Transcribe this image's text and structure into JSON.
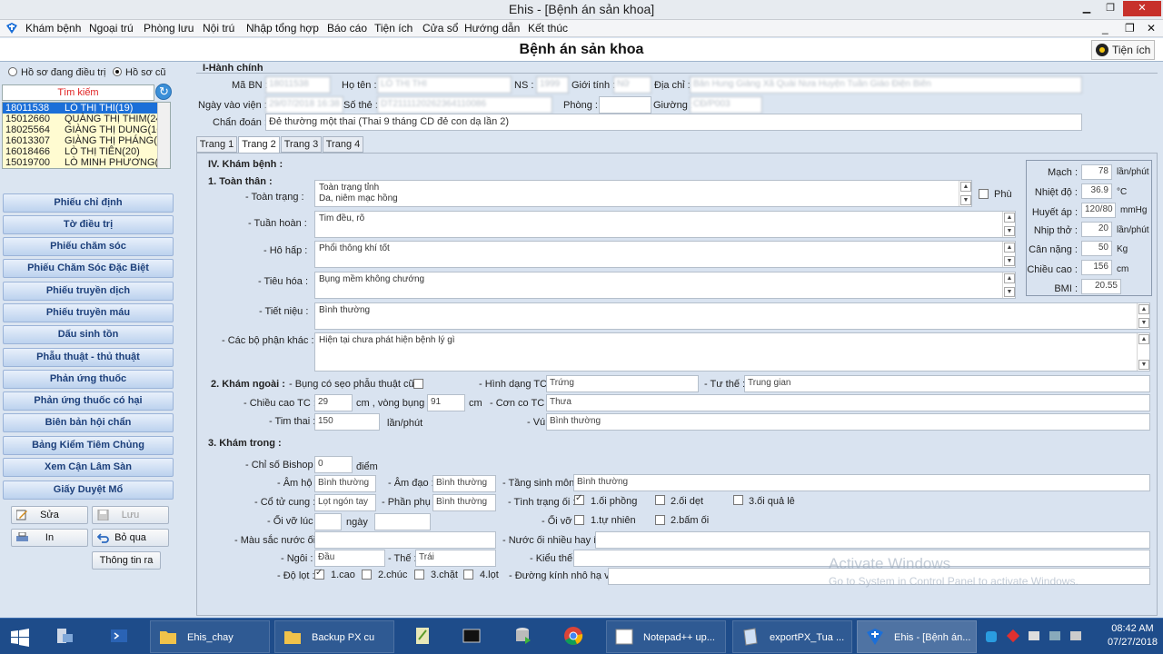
{
  "window": {
    "title": "Ehis - [Bệnh án sản khoa]",
    "controls": [
      "▁",
      "❐",
      "✕"
    ],
    "inner_controls": [
      "_",
      "❐",
      "✕"
    ]
  },
  "menu": [
    "Khám bệnh",
    "Ngoại trú",
    "Phòng lưu",
    "Nội trú",
    "Nhập tổng hợp",
    "Báo cáo",
    "Tiện ích",
    "Cửa sổ",
    "Hướng dẫn",
    "Kết thúc"
  ],
  "page_title": "Bệnh án sản khoa",
  "tienich_label": "Tiện ích",
  "left": {
    "radio1": "Hồ sơ đang điều trị",
    "radio2": "Hồ sơ cũ",
    "search_label": "Tìm kiếm",
    "patients": [
      [
        "18011538",
        "LÒ THỊ THI(19)"
      ],
      [
        "15012660",
        "QUÀNG THỊ THIM(24)"
      ],
      [
        "18025564",
        "GIÀNG THỊ DUNG(16)"
      ],
      [
        "16013307",
        "GIÀNG THỊ PHÁNG(19)"
      ],
      [
        "16018466",
        "LÒ THỊ TIÊN(20)"
      ],
      [
        "15019700",
        "LÒ MINH PHƯƠNG(18)"
      ]
    ],
    "nav": [
      "Phiếu chỉ định",
      "Tờ điều trị",
      "Phiếu chăm sóc",
      "Phiếu Chăm Sóc Đặc Biệt",
      "Phiếu truyền dịch",
      "Phiếu truyền máu",
      "Dấu sinh tồn",
      "Phẫu thuật - thủ thuật",
      "Phản ứng thuốc",
      "Phản ứng thuốc có hại",
      "Biên bản hội chẩn",
      "Bảng Kiểm Tiêm Chủng",
      "Xem Cận Lâm Sàn",
      "Giấy Duyệt Mổ"
    ],
    "sua": "Sửa",
    "luu": "Lưu",
    "in": "In",
    "boqua": "Bỏ qua",
    "thongtinra": "Thông tin ra"
  },
  "hanhchinh": {
    "title": "I-Hành chính",
    "maBN_label": "Mã BN :",
    "maBN": "18011538",
    "hoten_label": "Họ tên :",
    "hoten": "LÒ THỊ THI",
    "ns_label": "NS :",
    "ns": "1999",
    "gioitinh_label": "Giới tính :",
    "gioitinh": "Nữ",
    "diachi_label": "Địa chỉ :",
    "diachi": "Bản Hung Giàng Xã Quài Nưa Huyện Tuần Giáo Điện Biên",
    "ngayvao_label": "Ngày vào viện :",
    "ngayvao": "29/07/2018 16:38",
    "sothe_label": "Số thẻ :",
    "sothe": "DT2111120262364110086",
    "phong_label": "Phòng :",
    "phong": "",
    "giuong_label": "Giường :",
    "giuong": "CĐ/P003",
    "chandoan_label": "Chẩn đoán :",
    "chandoan": "Đẻ thường một thai (Thai 9 tháng CD đẻ con dạ lần 2)"
  },
  "tabs": [
    "Trang 1",
    "Trang 2",
    "Trang 3",
    "Trang 4"
  ],
  "kham": {
    "title": "IV. Khám bệnh :",
    "toanthan_title": "1. Toàn thân :",
    "toantrang_label": "- Toàn trạng :",
    "toantrang": "Toàn trạng tỉnh\nDa, niêm mạc hồng",
    "phu_label": "Phù",
    "tuanhoan_label": "- Tuần hoàn :",
    "tuanhoan": "Tim đều, rõ",
    "hohap_label": "- Hô hấp :",
    "hohap": "Phổi thông khí tốt",
    "tieuhoa_label": "- Tiêu hóa :",
    "tieuhoa": "Bụng mềm không chướng",
    "tietnieu_label": "- Tiết niệu :",
    "tietnieu": "Bình thường",
    "cacbophan_label": "- Các bộ phận khác :",
    "cacbophan": "Hiện tại chưa phát hiện bệnh lý gì"
  },
  "vitals": [
    {
      "label": "Mạch :",
      "value": "78",
      "unit": "lần/phút"
    },
    {
      "label": "Nhiệt độ :",
      "value": "36.9",
      "unit": "°C"
    },
    {
      "label": "Huyết áp :",
      "value": "120/80",
      "unit": "mmHg"
    },
    {
      "label": "Nhịp thở :",
      "value": "20",
      "unit": "lần/phút"
    },
    {
      "label": "Cân nặng :",
      "value": "50",
      "unit": "Kg"
    },
    {
      "label": "Chiều cao :",
      "value": "156",
      "unit": "cm"
    },
    {
      "label": "BMI :",
      "value": "20.55",
      "unit": ""
    }
  ],
  "khamngoai": {
    "title": "2. Khám ngoài :",
    "sepmo_label": "- Bụng có sẹo phẫu thuật cũ :",
    "hinhdang_label": "- Hình dạng TC :",
    "hinhdang": "Trứng",
    "tuthe_label": "- Tư thế :",
    "tuthe": "Trung gian",
    "chieucao_label": "- Chiều cao TC :",
    "chieucao": "29",
    "cm1": "cm , vòng bụng :",
    "vongbung": "91",
    "cm2": "cm",
    "conco_label": "- Cơn co TC :",
    "conco": "Thưa",
    "timthai_label": "- Tim thai :",
    "timthai": "150",
    "timthai_unit": "lần/phút",
    "vu_label": "- Vú :",
    "vu": "Bình thường"
  },
  "khamtrong": {
    "title": "3. Khám trong :",
    "bishop_label": "- Chỉ số Bishop :",
    "bishop": "0",
    "diem": "điểm",
    "amho_label": "- Âm hộ :",
    "amho": "Bình thường",
    "amdao_label": "- Âm đạo :",
    "amdao": "Bình thường",
    "tangsinh_label": "- Tầng sinh môn :",
    "tangsinh": "Bình thường",
    "cotucung_label": "- Cổ tử cung :",
    "cotucung": "Lọt ngón tay",
    "phanphu_label": "- Phần phụ :",
    "phanphu": "Bình thường",
    "tinhtrangoi_label": "- Tình trạng ối :",
    "oi1": "1.ối phồng",
    "oi2": "2.ối dẹt",
    "oi3": "3.ối quả lê",
    "oivo_luc_label": "- Ối vỡ lúc :",
    "ngay": "ngày",
    "oivo_label": "- Ối vỡ :",
    "ov1": "1.tự nhiên",
    "ov2": "2.bấm ối",
    "mausac_label": "- Màu sắc nước ối :",
    "nuocoi_label": "- Nước ối nhiều hay ít :",
    "ngoi_label": "- Ngôi :",
    "ngoi": "Đầu",
    "the_label": "- Thế :",
    "the": "Trái",
    "kieuthe_label": "- Kiểu thế :",
    "dolot_label": "- Độ lọt :",
    "dl1": "1.cao",
    "dl2": "2.chúc",
    "dl3": "3.chặt",
    "dl4": "4.lọt",
    "duongkinh_label": "- Đường kính nhô hạ vệ :"
  },
  "watermark": {
    "line1": "Activate Windows",
    "line2": "Go to System in Control Panel to activate Windows."
  },
  "taskbar": {
    "items": [
      "Ehis_chay",
      "Backup PX cu",
      "Notepad++ up...",
      "exportPX_Tua ...",
      "Ehis - [Bệnh án..."
    ],
    "time": "08:42 AM",
    "date": "07/27/2018"
  }
}
